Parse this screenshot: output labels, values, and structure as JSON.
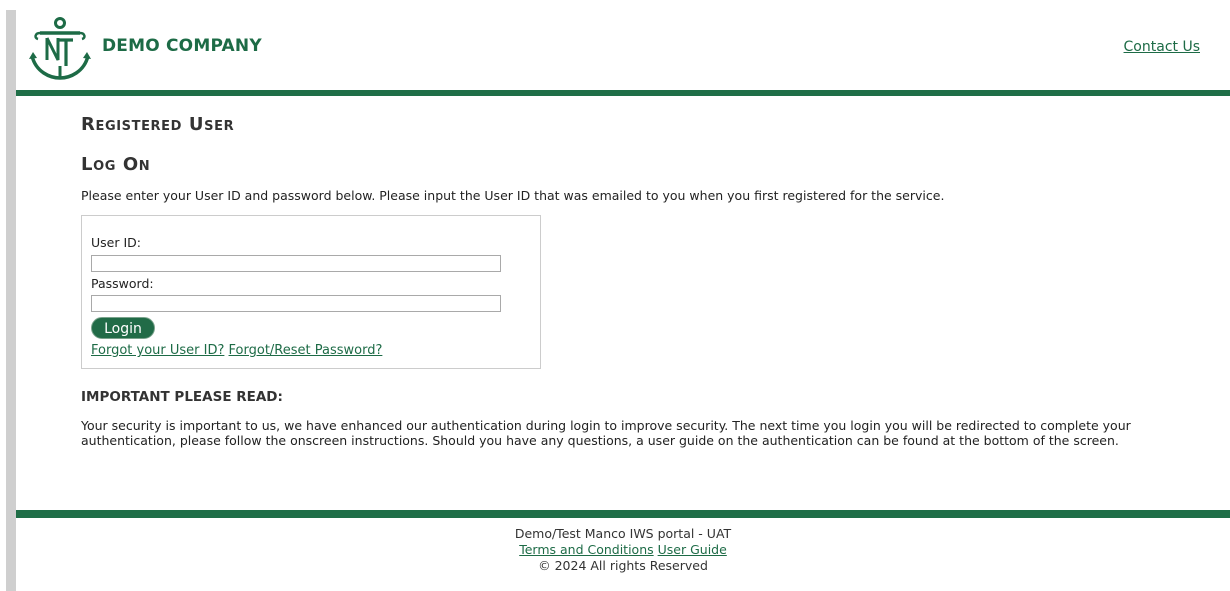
{
  "header": {
    "brand_name": "DEMO COMPANY",
    "contact_label": "Contact Us",
    "logo_icon": "anchor-nt-logo-icon",
    "brand_color": "#1d6b46"
  },
  "main": {
    "registered_title": "Registered User",
    "logon_title": "Log On",
    "instruction": "Please enter your User ID and password below. Please input the User ID that was emailed to you when you first registered for the service.",
    "login_form": {
      "userid_label": "User ID:",
      "userid_value": "",
      "password_label": "Password:",
      "password_value": "",
      "login_button": "Login",
      "forgot_userid": "Forgot your User ID?",
      "forgot_password": "Forgot/Reset Password?"
    },
    "important_heading": "IMPORTANT PLEASE READ:",
    "important_text": "Your security is important to us, we have enhanced our authentication during login to improve security. The next time you login you will be redirected to complete your authentication, please follow the onscreen instructions. Should you have any questions, a user guide on the authentication can be found at the bottom of the screen."
  },
  "footer": {
    "portal_name": "Demo/Test Manco IWS portal - UAT",
    "terms_label": "Terms and Conditions",
    "guide_label": "User Guide",
    "copyright": "© 2024 All rights Reserved"
  }
}
